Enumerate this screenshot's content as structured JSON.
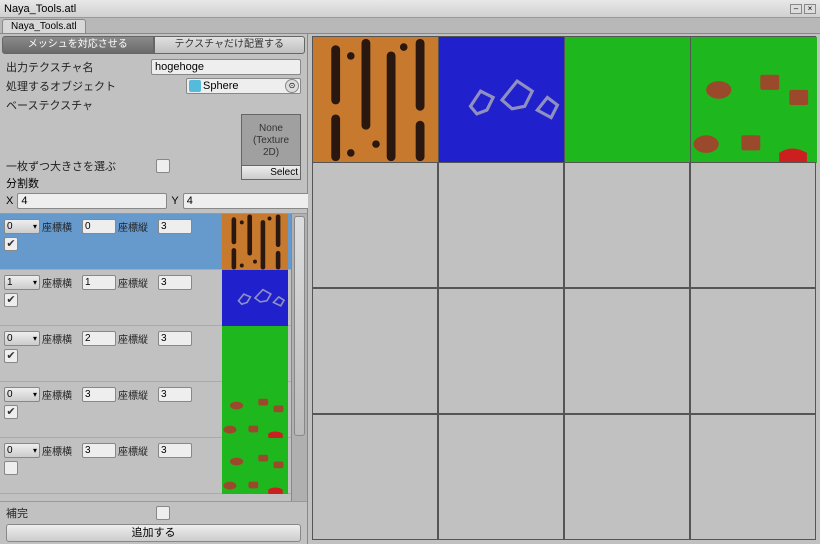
{
  "window": {
    "title": "Naya_Tools.atl"
  },
  "tab": "Naya_Tools.atl",
  "modeTabs": {
    "active": "メッシュを対応させる",
    "inactive": "テクスチャだけ配置する"
  },
  "fields": {
    "outputTexLabel": "出力テクスチャ名",
    "outputTexValue": "hogehoge",
    "targetObjLabel": "処理するオブジェクト",
    "targetObjValue": "Sphere",
    "baseTexLabel": "ベーステクスチャ",
    "texSlotNone": "None\n(Texture\n2D)",
    "texSlotSelect": "Select"
  },
  "sizeEach": {
    "label": "一枚ずつ大きさを選ぶ",
    "checked": false
  },
  "division": {
    "label": "分割数",
    "xLabel": "X",
    "xValue": "4",
    "yLabel": "Y",
    "yValue": "4"
  },
  "coordLabels": {
    "h": "座標横",
    "v": "座標縦"
  },
  "items": [
    {
      "dd": "0",
      "h": "0",
      "v": "3",
      "chk": true,
      "thumb": "orange",
      "selected": true
    },
    {
      "dd": "1",
      "h": "1",
      "v": "3",
      "chk": true,
      "thumb": "blue",
      "selected": false
    },
    {
      "dd": "0",
      "h": "2",
      "v": "3",
      "chk": true,
      "thumb": "green",
      "selected": false
    },
    {
      "dd": "0",
      "h": "3",
      "v": "3",
      "chk": true,
      "thumb": "green2",
      "selected": false
    },
    {
      "dd": "0",
      "h": "3",
      "v": "3",
      "chk": false,
      "thumb": "green2",
      "selected": false
    }
  ],
  "bottom": {
    "fillLabel": "補完",
    "fillChecked": false,
    "addButton": "追加する"
  },
  "grid": {
    "cols": 4,
    "rows": 4,
    "placed": [
      {
        "col": 0,
        "row": 0,
        "thumb": "orange"
      },
      {
        "col": 1,
        "row": 0,
        "thumb": "blue"
      },
      {
        "col": 2,
        "row": 0,
        "thumb": "green"
      },
      {
        "col": 3,
        "row": 0,
        "thumb": "green2"
      }
    ]
  }
}
